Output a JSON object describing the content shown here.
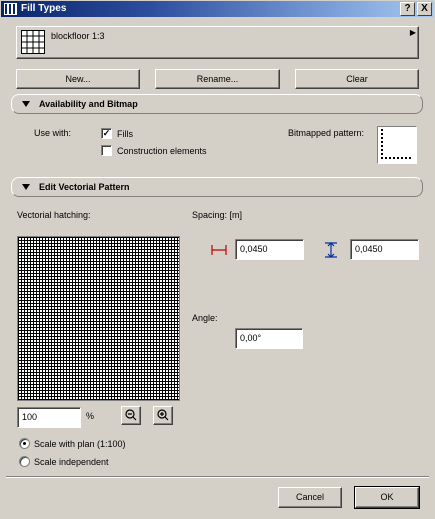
{
  "window": {
    "title": "Fill Types",
    "help_label": "?",
    "close_label": "X"
  },
  "pattern_selector": {
    "value": "blockfloor 1:3"
  },
  "actions": {
    "new_label": "New...",
    "rename_label": "Rename...",
    "clear_label": "Clear"
  },
  "availability": {
    "header": "Availability and Bitmap",
    "use_with_label": "Use with:",
    "fills": {
      "label": "Fills",
      "checked": true,
      "mark": "✓"
    },
    "construction": {
      "label": "Construction elements",
      "checked": false,
      "mark": ""
    },
    "bitmapped_pattern_label": "Bitmapped pattern:"
  },
  "vectorial": {
    "header": "Edit Vectorial Pattern",
    "hatching_label": "Vectorial hatching:",
    "spacing_label": "Spacing: [m]",
    "spacing_x": "0,0450",
    "spacing_y": "0,0450",
    "angle_label": "Angle:",
    "angle": "0,00°",
    "zoom_value": "100",
    "zoom_unit": "%",
    "scale_with_plan_label": "Scale with plan (1:100)",
    "scale_independent_label": "Scale independent",
    "scale_mode": "with_plan"
  },
  "footer": {
    "cancel_label": "Cancel",
    "ok_label": "OK"
  }
}
